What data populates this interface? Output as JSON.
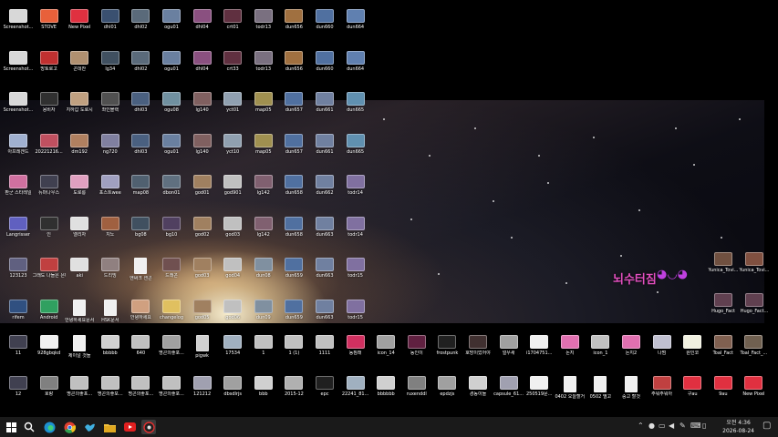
{
  "watermark": {
    "text": "뇌수터짐",
    "emoji": "◕◡◕"
  },
  "taskbar": {
    "time": "오전 4:36",
    "date": "2026-08-24"
  },
  "icons": [
    {
      "label": "Screenshot...",
      "color": "#d8d8d8",
      "doc": false
    },
    {
      "label": "STOVE",
      "color": "#e8603a",
      "doc": false
    },
    {
      "label": "New Pixel",
      "color": "#e03040",
      "doc": false
    },
    {
      "label": "dhl01",
      "color": "#3a5070",
      "doc": false
    },
    {
      "label": "dhl02",
      "color": "#5a6a7a",
      "doc": false
    },
    {
      "label": "ogu01",
      "color": "#6a80a0",
      "doc": false
    },
    {
      "label": "dhl04",
      "color": "#8a5080",
      "doc": false
    },
    {
      "label": "crt01",
      "color": "#603040",
      "doc": false
    },
    {
      "label": "todr13",
      "color": "#7a7080",
      "doc": false
    },
    {
      "label": "dun656",
      "color": "#a07040",
      "doc": false
    },
    {
      "label": "dun660",
      "color": "#5070a0",
      "doc": false
    },
    {
      "label": "dun664",
      "color": "#6080b0",
      "doc": false
    },
    {
      "label": "Screenshot...",
      "color": "#d8d8d8",
      "doc": false
    },
    {
      "label": "망토로고",
      "color": "#c03030",
      "doc": false
    },
    {
      "label": "곤데찬",
      "color": "#b09070",
      "doc": false
    },
    {
      "label": "lg34",
      "color": "#405060",
      "doc": false
    },
    {
      "label": "dhl02",
      "color": "#5a6a7a",
      "doc": false
    },
    {
      "label": "ogu01",
      "color": "#6a80a0",
      "doc": false
    },
    {
      "label": "dhl04",
      "color": "#8a5080",
      "doc": false
    },
    {
      "label": "crt33",
      "color": "#603040",
      "doc": false
    },
    {
      "label": "todr13",
      "color": "#7a7080",
      "doc": false
    },
    {
      "label": "dun656",
      "color": "#a07040",
      "doc": false
    },
    {
      "label": "dun660",
      "color": "#5070a0",
      "doc": false
    },
    {
      "label": "dun664",
      "color": "#6080b0",
      "doc": false
    },
    {
      "label": "Screenshot...",
      "color": "#d8d8d8",
      "doc": false
    },
    {
      "label": "옹비자",
      "color": "#303030",
      "doc": false
    },
    {
      "label": "지하갑 도로시",
      "color": "#c0a080",
      "doc": false
    },
    {
      "label": "좌인블랙",
      "color": "#505050",
      "doc": false
    },
    {
      "label": "dhl03",
      "color": "#4a6080",
      "doc": false
    },
    {
      "label": "ogu08",
      "color": "#7090a0",
      "doc": false
    },
    {
      "label": "lg140",
      "color": "#806060",
      "doc": false
    },
    {
      "label": "yct01",
      "color": "#90a0b0",
      "doc": false
    },
    {
      "label": "map05",
      "color": "#a09050",
      "doc": false
    },
    {
      "label": "dun657",
      "color": "#5070a0",
      "doc": false
    },
    {
      "label": "dun661",
      "color": "#7080a0",
      "doc": false
    },
    {
      "label": "dun665",
      "color": "#6090b0",
      "doc": false
    },
    {
      "label": "아프레겐드",
      "color": "#a0b0d0",
      "doc": false
    },
    {
      "label": "20221216...",
      "color": "#c05060",
      "doc": false
    },
    {
      "label": "dm192",
      "color": "#b08060",
      "doc": false
    },
    {
      "label": "ng720",
      "color": "#8080a0",
      "doc": false
    },
    {
      "label": "dhl03",
      "color": "#4a6080",
      "doc": false
    },
    {
      "label": "ogu01",
      "color": "#6a80a0",
      "doc": false
    },
    {
      "label": "lg140",
      "color": "#806060",
      "doc": false
    },
    {
      "label": "yct10",
      "color": "#90a0b0",
      "doc": false
    },
    {
      "label": "map05",
      "color": "#a09050",
      "doc": false
    },
    {
      "label": "dun657",
      "color": "#5070a0",
      "doc": false
    },
    {
      "label": "dun661",
      "color": "#7080a0",
      "doc": false
    },
    {
      "label": "dun665",
      "color": "#6090b0",
      "doc": false
    },
    {
      "label": "환군 스타레일",
      "color": "#d070a0",
      "doc": false
    },
    {
      "label": "듀마나우스",
      "color": "#404050",
      "doc": false
    },
    {
      "label": "도로롱",
      "color": "#e0a0c0",
      "doc": false
    },
    {
      "label": "포스트wee",
      "color": "#a0a0c0",
      "doc": false
    },
    {
      "label": "map08",
      "color": "#506070",
      "doc": false
    },
    {
      "label": "dbon01",
      "color": "#607080",
      "doc": false
    },
    {
      "label": "god01",
      "color": "#a08060",
      "doc": false
    },
    {
      "label": "god901",
      "color": "#c0c0c0",
      "doc": false
    },
    {
      "label": "lg142",
      "color": "#806070",
      "doc": false
    },
    {
      "label": "dun658",
      "color": "#5070a0",
      "doc": false
    },
    {
      "label": "dun662",
      "color": "#7080a0",
      "doc": false
    },
    {
      "label": "todr14",
      "color": "#8070a0",
      "doc": false
    },
    {
      "label": "Langrisser",
      "color": "#6060c0",
      "doc": false
    },
    {
      "label": "인",
      "color": "#303030",
      "doc": false
    },
    {
      "label": "엘리자",
      "color": "#e0e0e0",
      "doc": false
    },
    {
      "label": "지노",
      "color": "#a06040",
      "doc": false
    },
    {
      "label": "bg08",
      "color": "#405060",
      "doc": false
    },
    {
      "label": "bg10",
      "color": "#504060",
      "doc": false
    },
    {
      "label": "god02",
      "color": "#a08060",
      "doc": false
    },
    {
      "label": "god03",
      "color": "#c0c0c0",
      "doc": false
    },
    {
      "label": "lg142",
      "color": "#806070",
      "doc": false
    },
    {
      "label": "dun658",
      "color": "#5070a0",
      "doc": false
    },
    {
      "label": "dun663",
      "color": "#7080a0",
      "doc": false
    },
    {
      "label": "todr14",
      "color": "#8070a0",
      "doc": false
    },
    {
      "label": "123123",
      "color": "#606080",
      "doc": false
    },
    {
      "label": "그래도 나들은 은다",
      "color": "#c04040",
      "doc": false
    },
    {
      "label": "aki",
      "color": "#e0e0e0",
      "doc": false
    },
    {
      "label": "드리밍",
      "color": "#908080",
      "doc": false
    },
    {
      "label": "엔써크 센콘",
      "color": "#f0f0f0",
      "doc": true
    },
    {
      "label": "드래곤",
      "color": "#705050",
      "doc": false
    },
    {
      "label": "god03",
      "color": "#a08060",
      "doc": false
    },
    {
      "label": "god04",
      "color": "#c0c0c0",
      "doc": false
    },
    {
      "label": "dun08",
      "color": "#8090a0",
      "doc": false
    },
    {
      "label": "dun659",
      "color": "#5070a0",
      "doc": false
    },
    {
      "label": "dun663",
      "color": "#7080a0",
      "doc": false
    },
    {
      "label": "todr15",
      "color": "#8070a0",
      "doc": false
    },
    {
      "label": "rifem",
      "color": "#305080",
      "doc": false
    },
    {
      "label": "Android",
      "color": "#30a060",
      "doc": false
    },
    {
      "label": "안녕하세요문서",
      "color": "#f0f0f0",
      "doc": true
    },
    {
      "label": "HSK문서",
      "color": "#f0f0f0",
      "doc": true
    },
    {
      "label": "안녕하세요",
      "color": "#d0a080",
      "doc": false
    },
    {
      "label": "changelog",
      "color": "#e0c060",
      "doc": false
    },
    {
      "label": "god05",
      "color": "#a08060",
      "doc": false
    },
    {
      "label": "god06",
      "color": "#c0c0c0",
      "doc": false
    },
    {
      "label": "dun09",
      "color": "#8090a0",
      "doc": false
    },
    {
      "label": "dun659",
      "color": "#5070a0",
      "doc": false
    },
    {
      "label": "dun663",
      "color": "#7080a0",
      "doc": false
    },
    {
      "label": "todr15",
      "color": "#8070a0",
      "doc": false
    },
    {
      "label": "11",
      "color": "#404050",
      "doc": false
    },
    {
      "label": "928gbqkd",
      "color": "#f0f0f0",
      "doc": false
    },
    {
      "label": "제이널 것들",
      "color": "#f0f0f0",
      "doc": true
    },
    {
      "label": "bbbbb",
      "color": "#d0d0d0",
      "doc": false
    },
    {
      "label": "640",
      "color": "#c0c0c0",
      "doc": false
    },
    {
      "label": "명곤의좋포...",
      "color": "#a0a0a0",
      "doc": false
    },
    {
      "label": "pigwk",
      "color": "#d0d0d0",
      "doc": true
    },
    {
      "label": "17534",
      "color": "#a0b0c0",
      "doc": false
    },
    {
      "label": "1",
      "color": "#c0c0c0",
      "doc": false
    },
    {
      "label": "1 (1)",
      "color": "#c0c0c0",
      "doc": false
    },
    {
      "label": "1111",
      "color": "#c0c0c0",
      "doc": false
    },
    {
      "label": "동짐래",
      "color": "#d03060",
      "doc": false
    },
    {
      "label": "icon_14",
      "color": "#a0a0a0",
      "doc": false
    },
    {
      "label": "동인이",
      "color": "#602040",
      "doc": false
    },
    {
      "label": "frostpunk",
      "color": "#202020",
      "doc": false
    },
    {
      "label": "호방이었어야",
      "color": "#403030",
      "doc": false
    },
    {
      "label": "얼우새",
      "color": "#a0a0a0",
      "doc": false
    },
    {
      "label": "i1704751...",
      "color": "#f0f0f0",
      "doc": false
    },
    {
      "label": "돈지",
      "color": "#e070b0",
      "doc": false
    },
    {
      "label": "icon_1",
      "color": "#c0c0c0",
      "doc": false
    },
    {
      "label": "돈지2",
      "color": "#e070b0",
      "doc": false
    },
    {
      "label": "나범",
      "color": "#c0c0d0",
      "doc": false
    },
    {
      "label": "원인코",
      "color": "#f0f0e0",
      "doc": false
    },
    {
      "label": "Toal_Fact",
      "color": "#806050",
      "doc": false
    },
    {
      "label": "Toal_Fact_...",
      "color": "#706050",
      "doc": false
    },
    {
      "label": "12",
      "color": "#404050",
      "doc": false
    },
    {
      "label": "호랑",
      "color": "#808080",
      "doc": false
    },
    {
      "label": "명곤의좋포...",
      "color": "#c0c0c0",
      "doc": false
    },
    {
      "label": "명곤의좋포...",
      "color": "#c0c0c0",
      "doc": false
    },
    {
      "label": "명곤의좋포...",
      "color": "#c0c0c0",
      "doc": false
    },
    {
      "label": "명곤의좋포...",
      "color": "#c0c0c0",
      "doc": false
    },
    {
      "label": "121212",
      "color": "#a0a0b0",
      "doc": false
    },
    {
      "label": "dbsdlrjs",
      "color": "#a0a0a0",
      "doc": false
    },
    {
      "label": "bbb",
      "color": "#d0d0d0",
      "doc": false
    },
    {
      "label": "2015-12",
      "color": "#b0b0b0",
      "doc": false
    },
    {
      "label": "epc",
      "color": "#202020",
      "doc": false
    },
    {
      "label": "22241_81...",
      "color": "#a0b0c0",
      "doc": false
    },
    {
      "label": "bbbbbb",
      "color": "#d0d0d0",
      "doc": false
    },
    {
      "label": "ruxenddl",
      "color": "#808080",
      "doc": false
    },
    {
      "label": "epdzjs",
      "color": "#a0a0a0",
      "doc": false
    },
    {
      "label": "경동이들",
      "color": "#d0d0d0",
      "doc": false
    },
    {
      "label": "capsule_61...",
      "color": "#a0a0b0",
      "doc": false
    },
    {
      "label": "250519문...",
      "color": "#f0f0f0",
      "doc": false
    },
    {
      "label": "0402 오늘할거",
      "color": "#f0f0f0",
      "doc": true
    },
    {
      "label": "0502 별고",
      "color": "#f0f0f0",
      "doc": true
    },
    {
      "label": "중고 할것",
      "color": "#f0f0f0",
      "doc": true
    },
    {
      "label": "주워주워아",
      "color": "#c04040",
      "doc": false
    },
    {
      "label": "구au",
      "color": "#e03040",
      "doc": false
    },
    {
      "label": "9au",
      "color": "#e03040",
      "doc": false
    },
    {
      "label": "New Pixel",
      "color": "#e03040",
      "doc": false
    }
  ],
  "extras": [
    {
      "label": "Yunica_Tovi...",
      "color": "#705040",
      "doc": false
    },
    {
      "label": "Yunica_Tovi...",
      "color": "#805040",
      "doc": false
    },
    {
      "label": "Hugo_Fact",
      "color": "#604050",
      "doc": false
    },
    {
      "label": "Hugo_Fact...",
      "color": "#604050",
      "doc": false
    }
  ]
}
